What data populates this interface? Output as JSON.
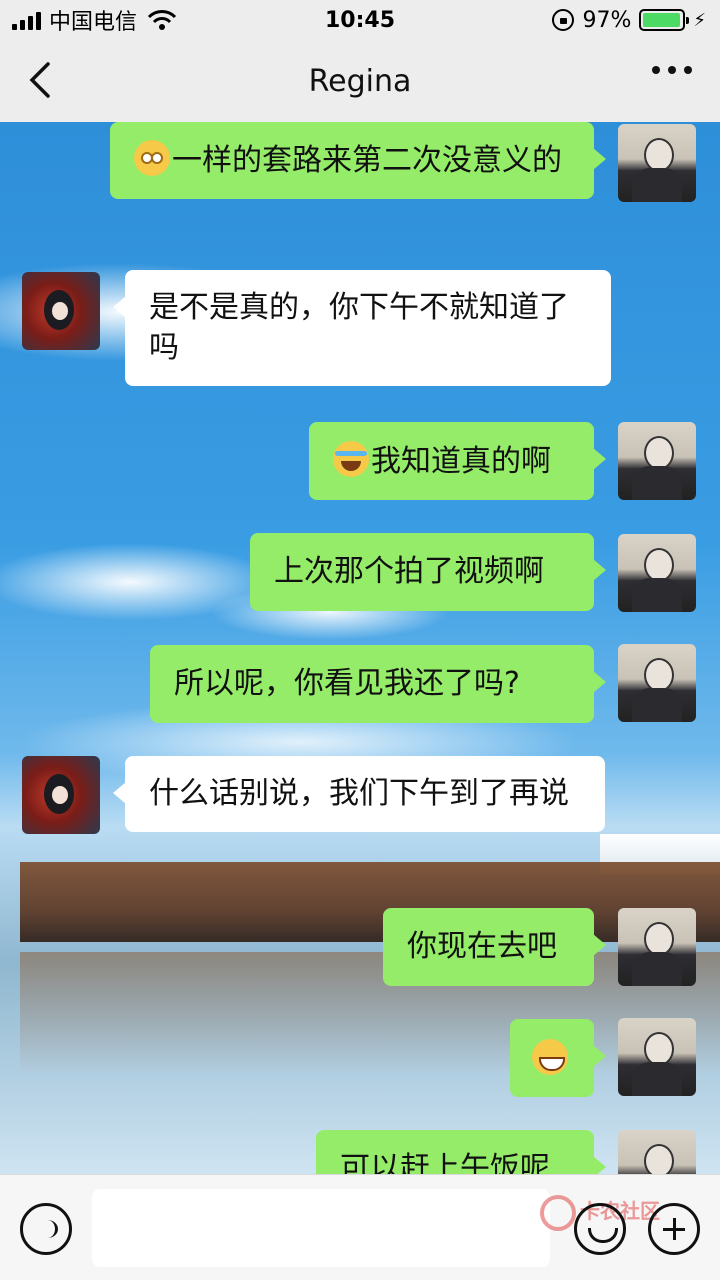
{
  "status_bar": {
    "carrier": "中国电信",
    "time": "10:45",
    "battery_percent": "97%",
    "battery_level": 0.97
  },
  "header": {
    "title": "Regina",
    "back_icon": "chevron-left-icon",
    "more_icon": "more-icon"
  },
  "messages": [
    {
      "sender": "me",
      "emoji": "flushed-face",
      "text": "一样的套路来第二次没意义的"
    },
    {
      "sender": "Regina",
      "text": "是不是真的，你下午不就知道了吗"
    },
    {
      "sender": "me",
      "emoji": "crying-laughing-face",
      "text": "我知道真的啊"
    },
    {
      "sender": "me",
      "text": "上次那个拍了视频啊"
    },
    {
      "sender": "me",
      "text": "所以呢，你看见我还了吗?"
    },
    {
      "sender": "Regina",
      "text": "什么话别说，我们下午到了再说"
    },
    {
      "sender": "me",
      "text": "你现在去吧"
    },
    {
      "sender": "me",
      "emoji": "grinning-sweat-face",
      "text": ""
    },
    {
      "sender": "me",
      "text": "可以赶上午饭呢"
    }
  ],
  "input_bar": {
    "voice_icon": "voice-icon",
    "emoji_icon": "smiley-icon",
    "plus_icon": "plus-icon",
    "message_value": ""
  },
  "watermark": {
    "text": "卡农社区"
  },
  "colors": {
    "outgoing_bubble": "#95ec69",
    "incoming_bubble": "#ffffff",
    "bar_background": "#ededed"
  }
}
